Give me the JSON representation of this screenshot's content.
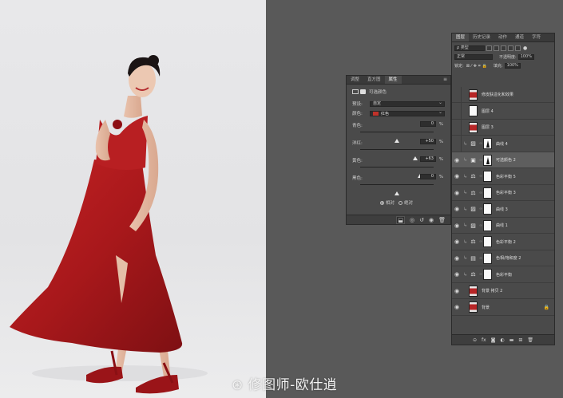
{
  "properties_panel": {
    "tabs": [
      "调整",
      "直方图",
      "属性"
    ],
    "active_tab": "属性",
    "title": "可选颜色",
    "preset_label": "预设:",
    "preset_value": "自定",
    "colors_label": "颜色:",
    "colors_value": "红色",
    "sliders": [
      {
        "label": "青色:",
        "value": "0",
        "unit": "%",
        "level": 0.5
      },
      {
        "label": "洋红:",
        "value": "+50",
        "unit": "%",
        "level": 0.75
      },
      {
        "label": "黄色:",
        "value": "+63",
        "unit": "%",
        "level": 0.82
      },
      {
        "label": "黑色:",
        "value": "0",
        "unit": "%",
        "level": 0.5
      }
    ],
    "mode_relative": "相对",
    "mode_absolute": "绝对",
    "selected_mode": "相对"
  },
  "layers_panel": {
    "tabs": [
      "图层",
      "历史记录",
      "动作",
      "通道",
      "字符"
    ],
    "active_tab": "图层",
    "filter_kind": "ρ 类型",
    "blend_mode": "正常",
    "opacity_label": "不透明度:",
    "opacity_value": "100%",
    "lock_label": "锁定:",
    "fill_label": "填充:",
    "fill_value": "100%",
    "layers": [
      {
        "name": "修皮肤溢化和效果",
        "kind": "photo",
        "visible": false,
        "selected": false
      },
      {
        "name": "图层 4",
        "kind": "white",
        "visible": false,
        "selected": false
      },
      {
        "name": "图层 3",
        "kind": "photo",
        "visible": false,
        "selected": false
      },
      {
        "name": "曲线 4",
        "kind": "curves",
        "visible": false,
        "selected": false
      },
      {
        "name": "可选颜色 2",
        "kind": "selective",
        "visible": true,
        "selected": true
      },
      {
        "name": "色彩平衡 5",
        "kind": "balance",
        "visible": true,
        "selected": false
      },
      {
        "name": "色彩平衡 3",
        "kind": "balance",
        "visible": true,
        "selected": false
      },
      {
        "name": "曲线 3",
        "kind": "curves",
        "visible": true,
        "selected": false
      },
      {
        "name": "曲线 1",
        "kind": "curves",
        "visible": true,
        "selected": false
      },
      {
        "name": "色彩平衡 2",
        "kind": "balance",
        "visible": true,
        "selected": false
      },
      {
        "name": "色相/饱和度 2",
        "kind": "hue",
        "visible": true,
        "selected": false
      },
      {
        "name": "色彩平衡",
        "kind": "balance",
        "visible": true,
        "selected": false
      },
      {
        "name": "背景 拷贝 2",
        "kind": "photo",
        "visible": true,
        "selected": false
      },
      {
        "name": "背景",
        "kind": "photo",
        "visible": true,
        "selected": false,
        "locked": true
      }
    ]
  },
  "watermark": "修图师-欧仕逍",
  "colors": {
    "dress_red": "#b11d1f",
    "panel": "#4a4a4a",
    "workspace": "#595959"
  }
}
